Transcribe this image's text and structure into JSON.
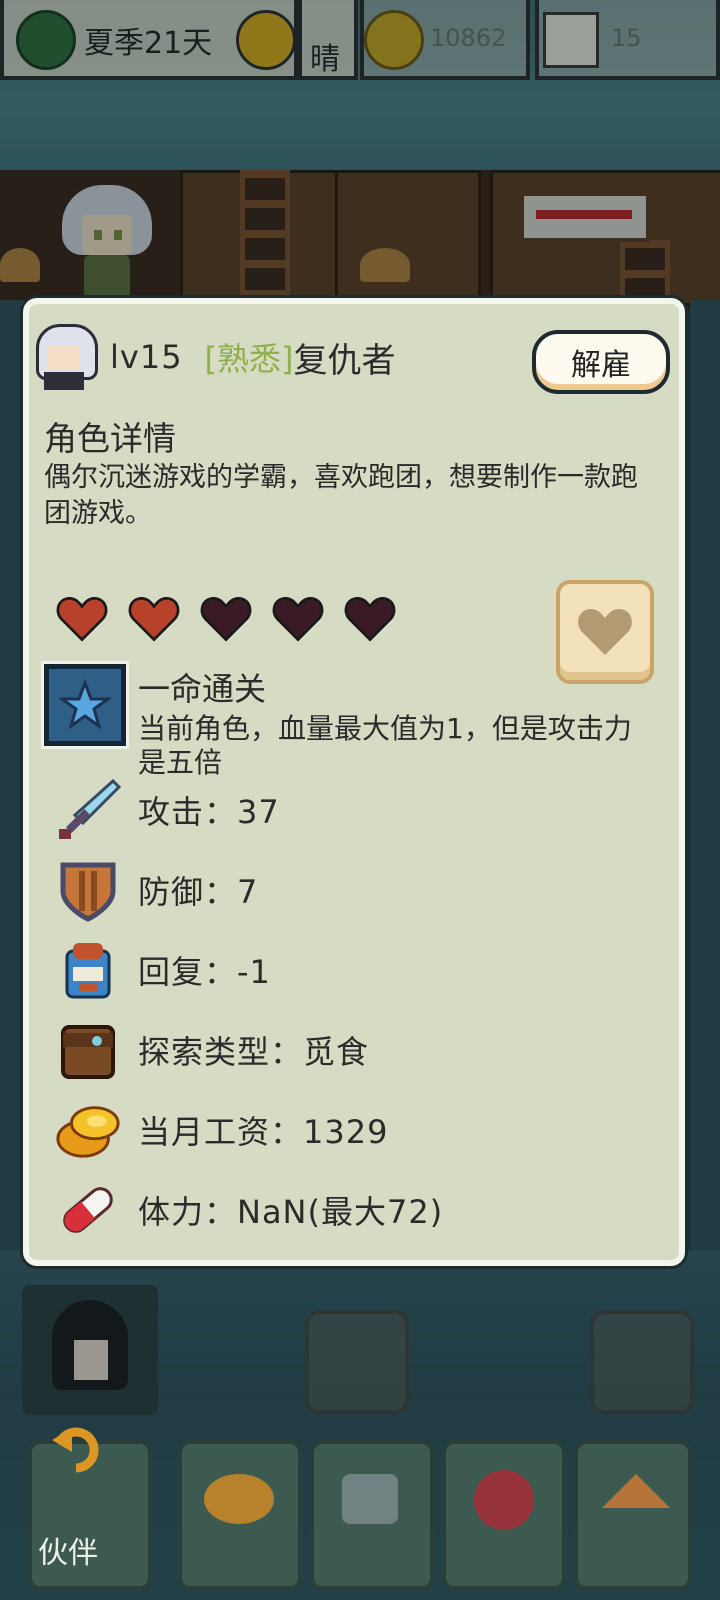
{
  "hud": {
    "date": "夏季21天",
    "weather": "晴",
    "coins": "10862",
    "time": "15"
  },
  "character": {
    "level": "lv15",
    "relation_tag": "[熟悉]",
    "name": "复仇者",
    "dismiss_label": "解雇",
    "details_title": "角色详情",
    "description": "偶尔沉迷游戏的学霸，喜欢跑团，想要制作一款跑团游戏。",
    "hearts_filled": 2,
    "hearts_total": 5
  },
  "skill": {
    "name": "一命通关",
    "description": "当前角色，血量最大值为1，但是攻击力是五倍"
  },
  "stats": [
    {
      "icon": "sword-icon",
      "label": "攻击：37"
    },
    {
      "icon": "shield-icon",
      "label": "防御：7"
    },
    {
      "icon": "backpack-icon",
      "label": "回复：-1"
    },
    {
      "icon": "satchel-icon",
      "label": "探索类型：觅食"
    },
    {
      "icon": "gold-coins-icon",
      "label": "当月工资：1329"
    },
    {
      "icon": "pill-icon",
      "label": "体力：NaN(最大72)"
    }
  ],
  "nav": {
    "partner_label": "伙伴"
  },
  "colors": {
    "panel_bg": "#d6dcc4",
    "tag_green": "#8fb04a",
    "heart_filled": "#b8412c",
    "heart_empty": "#3a1a24"
  }
}
